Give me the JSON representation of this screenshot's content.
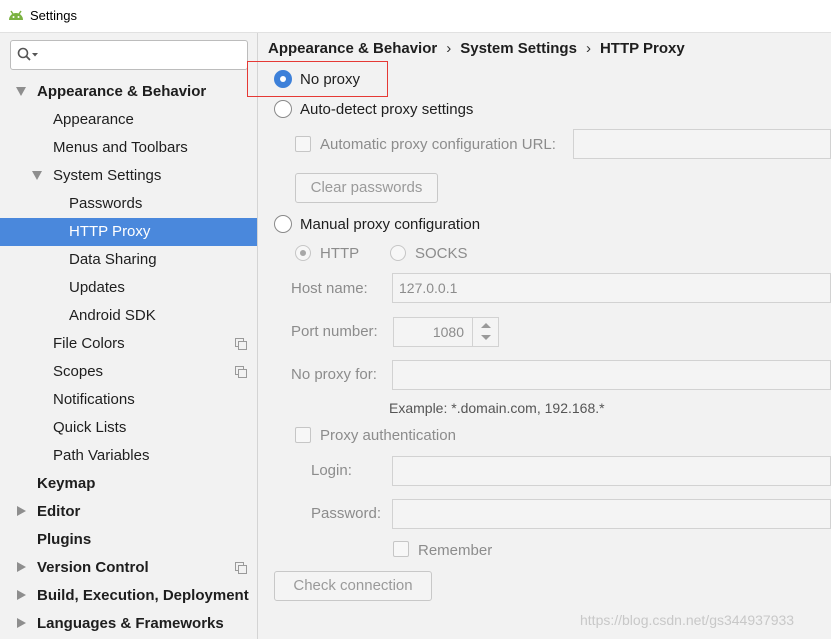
{
  "window": {
    "title": "Settings"
  },
  "search": {
    "value": "",
    "placeholder": ""
  },
  "sidebar": {
    "items": [
      {
        "label": "Appearance & Behavior"
      },
      {
        "label": "Appearance"
      },
      {
        "label": "Menus and Toolbars"
      },
      {
        "label": "System Settings"
      },
      {
        "label": "Passwords"
      },
      {
        "label": "HTTP Proxy"
      },
      {
        "label": "Data Sharing"
      },
      {
        "label": "Updates"
      },
      {
        "label": "Android SDK"
      },
      {
        "label": "File Colors"
      },
      {
        "label": "Scopes"
      },
      {
        "label": "Notifications"
      },
      {
        "label": "Quick Lists"
      },
      {
        "label": "Path Variables"
      },
      {
        "label": "Keymap"
      },
      {
        "label": "Editor"
      },
      {
        "label": "Plugins"
      },
      {
        "label": "Version Control"
      },
      {
        "label": "Build, Execution, Deployment"
      },
      {
        "label": "Languages & Frameworks"
      }
    ]
  },
  "breadcrumb": {
    "part1": "Appearance & Behavior",
    "sep": "›",
    "part2": "System Settings",
    "part3": "HTTP Proxy"
  },
  "proxy": {
    "no_proxy": "No proxy",
    "auto_detect": "Auto-detect proxy settings",
    "auto_url_label": "Automatic proxy configuration URL:",
    "auto_url_value": "",
    "clear_passwords": "Clear passwords",
    "manual": "Manual proxy configuration",
    "http": "HTTP",
    "socks": "SOCKS",
    "host_label": "Host name:",
    "host_value": "127.0.0.1",
    "port_label": "Port number:",
    "port_value": "1080",
    "no_proxy_for_label": "No proxy for:",
    "no_proxy_for_value": "",
    "example": "Example: *.domain.com, 192.168.*",
    "proxy_auth": "Proxy authentication",
    "login_label": "Login:",
    "login_value": "",
    "password_label": "Password:",
    "password_value": "",
    "remember": "Remember",
    "check_connection": "Check connection"
  },
  "watermark": "https://blog.csdn.net/gs344937933",
  "colors": {
    "selection": "#4a88dc",
    "radio_checked": "#3d80d9",
    "highlight": "#e53935"
  }
}
